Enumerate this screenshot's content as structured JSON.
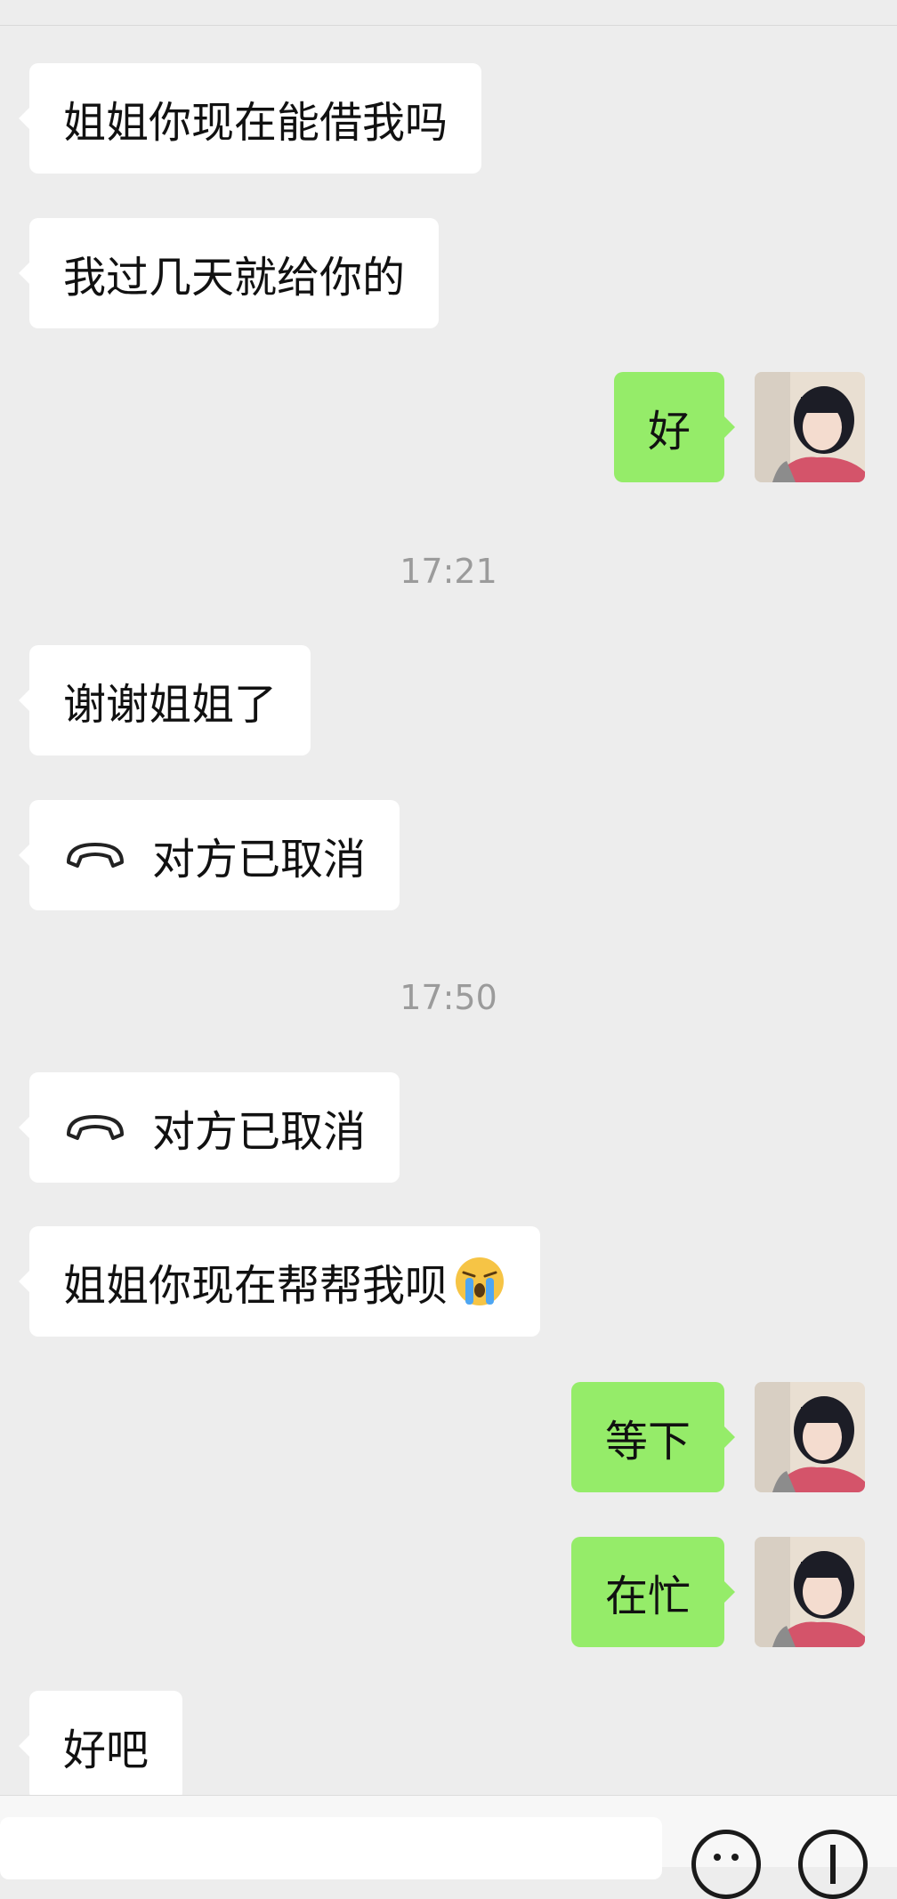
{
  "messages": [
    {
      "side": "left",
      "text": "姐姐你现在能借我吗"
    },
    {
      "side": "left",
      "text": "我过几天就给你的"
    },
    {
      "side": "right",
      "text": "好",
      "avatar": "user-avatar"
    },
    {
      "type": "time",
      "text": "17:21"
    },
    {
      "side": "left",
      "text": "谢谢姐姐了"
    },
    {
      "side": "left",
      "type": "call",
      "icon": "phone-hangup-icon",
      "text": "对方已取消"
    },
    {
      "type": "time",
      "text": "17:50"
    },
    {
      "side": "left",
      "type": "call",
      "icon": "phone-hangup-icon",
      "text": "对方已取消"
    },
    {
      "side": "left",
      "text": "姐姐你现在帮帮我呗",
      "emoji": "crying-face-emoji"
    },
    {
      "side": "right",
      "text": "等下",
      "avatar": "user-avatar"
    },
    {
      "side": "right",
      "text": "在忙",
      "avatar": "user-avatar"
    },
    {
      "side": "left",
      "text": "好吧"
    }
  ],
  "input_bar": {
    "icons": [
      "emoji-smiley-icon",
      "add-plus-icon"
    ]
  },
  "colors": {
    "background": "#ededed",
    "left_bubble": "#ffffff",
    "right_bubble": "#95ec69",
    "timestamp": "#9b9b9b"
  }
}
